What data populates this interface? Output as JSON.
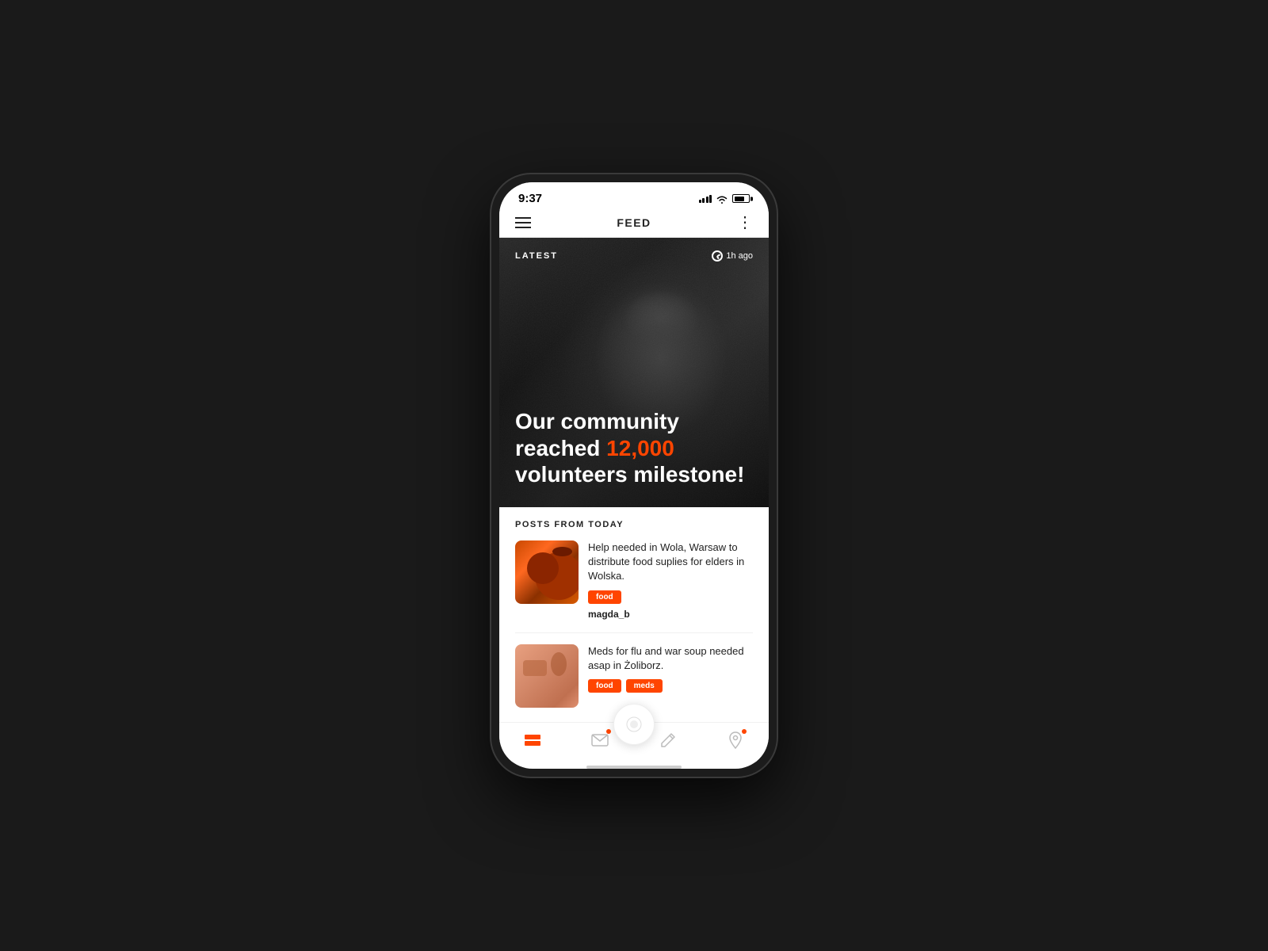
{
  "status_bar": {
    "time": "9:37"
  },
  "top_bar": {
    "title": "FEED",
    "menu_label": "☰",
    "more_label": "⋮"
  },
  "hero": {
    "badge": "LATEST",
    "time_ago": "1h ago",
    "headline_part1": "Our community reached ",
    "headline_highlight": "12,000",
    "headline_part2": " volunteers milestone!"
  },
  "posts": {
    "section_title": "POSTS FROM TODAY",
    "items": [
      {
        "id": "post-1",
        "description": "Help needed in Wola, Warsaw to distribute food suplies for elders in Wolska.",
        "tags": [
          "food"
        ],
        "author": "magda_b",
        "thumb_type": "food"
      },
      {
        "id": "post-2",
        "description": "Meds for flu and war soup needed asap in Żoliborz.",
        "tags": [
          "food",
          "meds"
        ],
        "author": "",
        "thumb_type": "meds"
      }
    ]
  },
  "bottom_nav": {
    "items": [
      {
        "id": "feed",
        "label": "feed",
        "active": true
      },
      {
        "id": "mail",
        "label": "mail",
        "active": false,
        "badge": true
      },
      {
        "id": "compose",
        "label": "compose",
        "active": false,
        "fab": true
      },
      {
        "id": "pen",
        "label": "pen",
        "active": false
      },
      {
        "id": "map",
        "label": "map",
        "active": false,
        "badge": true
      }
    ]
  }
}
